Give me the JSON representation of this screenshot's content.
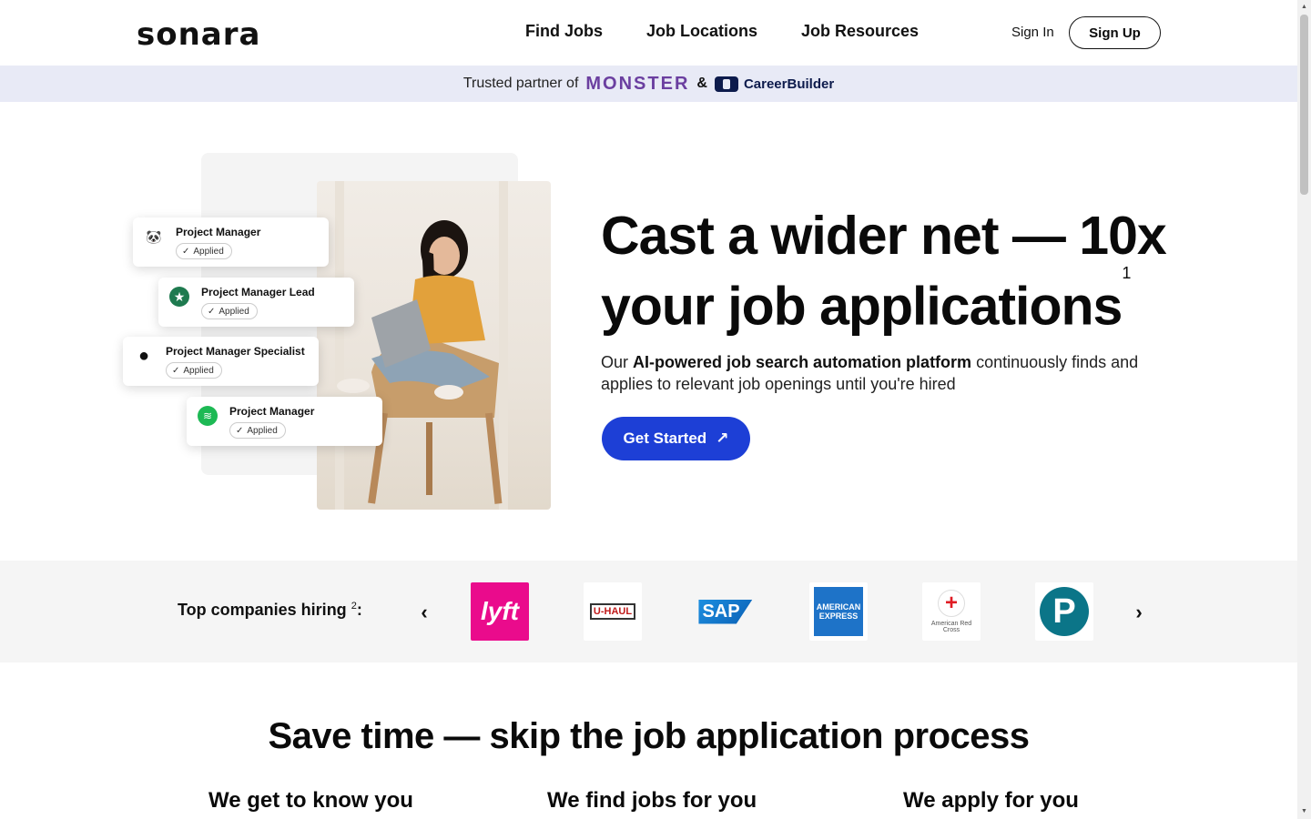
{
  "header": {
    "logo": "sonara",
    "nav": [
      "Find Jobs",
      "Job Locations",
      "Job Resources"
    ],
    "sign_in": "Sign In",
    "sign_up": "Sign Up"
  },
  "partner_bar": {
    "text": "Trusted partner of",
    "monster": "MONSTER",
    "amp": "&",
    "careerbuilder": "CareerBuilder"
  },
  "hero": {
    "cards": [
      {
        "title": "Project Manager",
        "badge": "Applied",
        "icon": "panda-icon",
        "icon_color": "#111111"
      },
      {
        "title": "Project Manager Lead",
        "badge": "Applied",
        "icon": "starbucks-icon",
        "icon_color": "#1e7a4f"
      },
      {
        "title": "Project Manager Specialist",
        "badge": "Applied",
        "icon": "apple-icon",
        "icon_color": "#111111"
      },
      {
        "title": "Project Manager",
        "badge": "Applied",
        "icon": "spotify-icon",
        "icon_color": "#1db954"
      }
    ],
    "headline_line1": "Cast a wider net — 10x",
    "headline_line2": "your job applications",
    "headline_sup": "1",
    "subtext_pre": "Our ",
    "subtext_bold": "AI-powered job search automation platform",
    "subtext_post": " continuously finds and applies to relevant job openings until you're hired",
    "cta": "Get Started",
    "cta_color": "#1d3fd6"
  },
  "companies": {
    "label": "Top companies hiring",
    "label_sup": "2",
    "label_colon": ":",
    "logos": [
      {
        "name": "lyft",
        "text": "lyft"
      },
      {
        "name": "uhaul",
        "text": "U-HAUL"
      },
      {
        "name": "sap",
        "text": "SAP"
      },
      {
        "name": "amex",
        "text": "AMERICAN EXPRESS"
      },
      {
        "name": "redcross",
        "text": "American Red Cross"
      },
      {
        "name": "pearson",
        "text": "P"
      }
    ]
  },
  "section": {
    "title": "Save time — skip the job application process",
    "columns": [
      "We get to know you",
      "We find jobs for you",
      "We apply for you"
    ]
  }
}
